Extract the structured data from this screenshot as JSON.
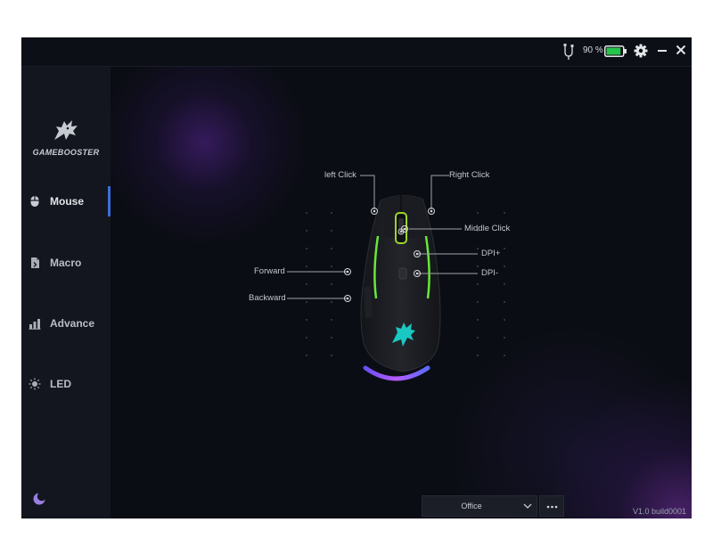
{
  "titlebar": {
    "battery_percent": "90 %",
    "icons": [
      "cable-icon",
      "battery-icon",
      "gear-icon",
      "minimize-icon",
      "close-icon"
    ],
    "battery_level": 0.9,
    "battery_color": "#27c44c"
  },
  "sidebar": {
    "logo_text": "GAMEBOOSTER",
    "items": [
      {
        "label": "Mouse",
        "icon": "mouse-icon",
        "active": true
      },
      {
        "label": "Macro",
        "icon": "macro-file-icon",
        "active": false
      },
      {
        "label": "Advance",
        "icon": "advance-chart-icon",
        "active": false
      },
      {
        "label": "LED",
        "icon": "led-bulb-icon",
        "active": false
      }
    ],
    "bottom_icon": "moon-icon",
    "accent_color": "#3b6fd8"
  },
  "mouse_buttons": {
    "left_click": "left Click",
    "right_click": "Right Click",
    "middle_click": "Middle Click",
    "dpi_plus": "DPI+",
    "dpi_minus": "DPI-",
    "forward": "Forward",
    "backward": "Backward"
  },
  "profile": {
    "selected": "Office",
    "more_label": "•••"
  },
  "version": "V1.0 build0001"
}
